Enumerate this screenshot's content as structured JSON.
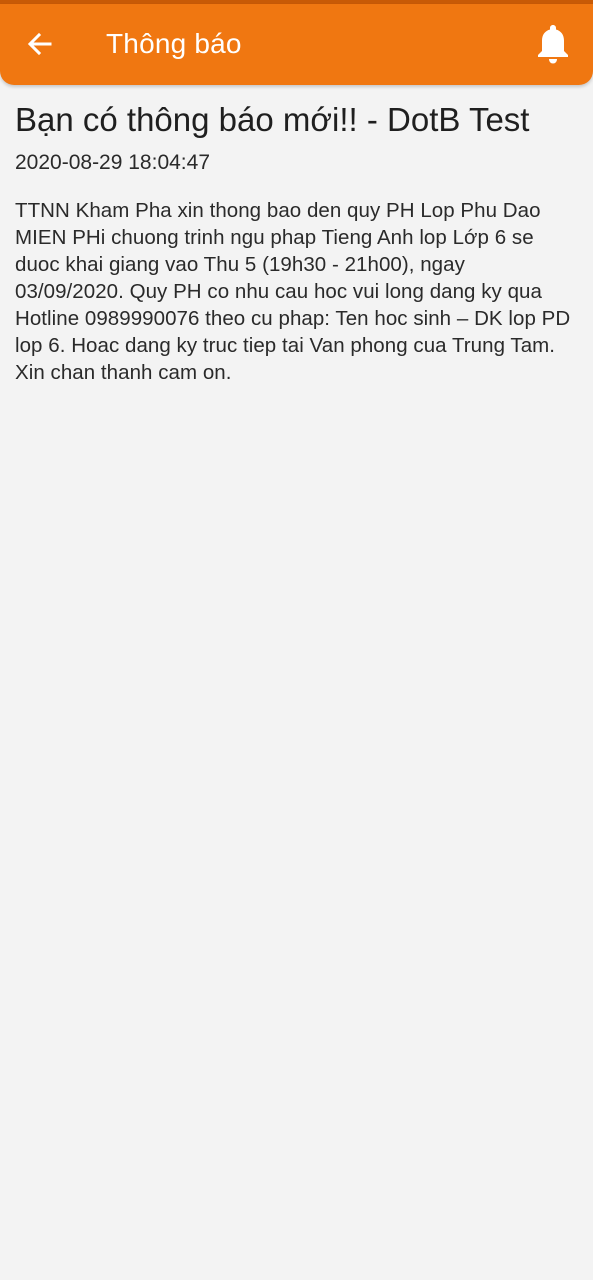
{
  "header": {
    "title": "Thông báo",
    "back_icon": "arrow-left-icon",
    "bell_icon": "bell-icon",
    "color": "#F07711"
  },
  "notification": {
    "title": "Bạn có thông báo mới!! - DotB Test",
    "timestamp": "2020-08-29 18:04:47",
    "body": "TTNN Kham Pha xin thong bao den quy PH Lop Phu Dao MIEN PHi chuong trinh ngu phap Tieng Anh lop Lớp 6 se duoc khai giang vao Thu 5 (19h30 - 21h00), ngay 03/09/2020. Quy PH co nhu cau hoc vui long dang ky qua Hotline 0989990076 theo cu phap: Ten hoc sinh – DK lop PD lop 6. Hoac dang ky truc tiep tai Van phong cua Trung Tam. Xin chan thanh cam on."
  }
}
